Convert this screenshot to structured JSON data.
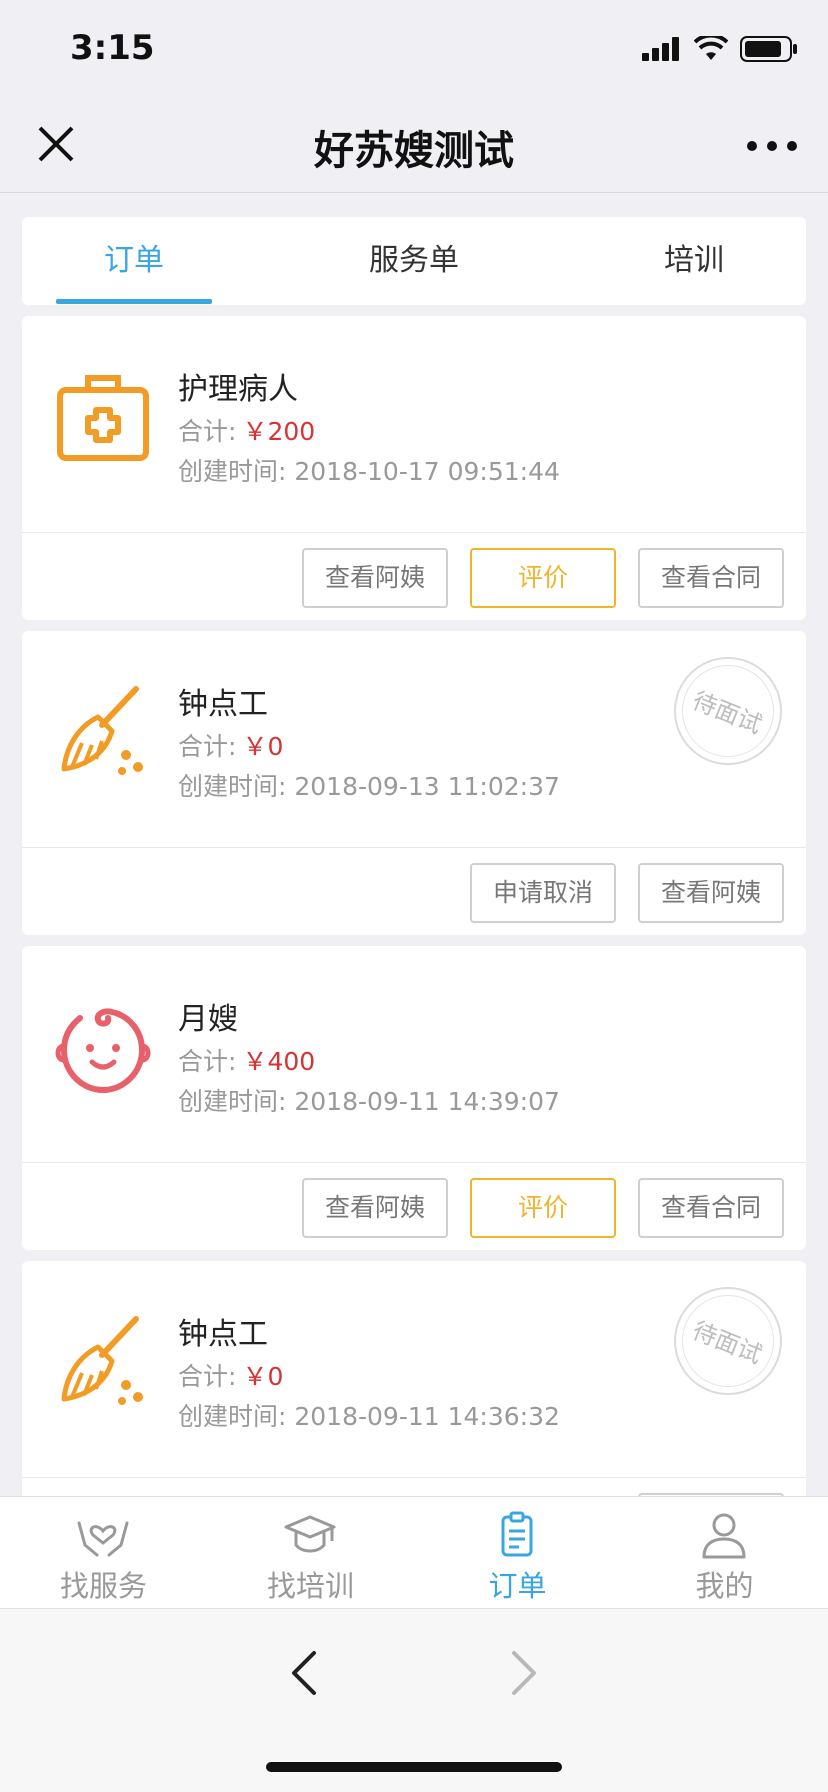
{
  "status_bar": {
    "time": "3:15"
  },
  "nav": {
    "title": "好苏嫂测试"
  },
  "tabs": [
    {
      "label": "订单",
      "active": true
    },
    {
      "label": "服务单",
      "active": false
    },
    {
      "label": "培训",
      "active": false
    }
  ],
  "orders": [
    {
      "icon": "medical-kit-icon",
      "title": "护理病人",
      "total_label": "合计:",
      "price": "￥200",
      "time": "创建时间: 2018-10-17 09:51:44",
      "stamp": "",
      "buttons": [
        "查看阿姨",
        "评价",
        "查看合同"
      ]
    },
    {
      "icon": "broom-icon",
      "title": "钟点工",
      "total_label": "合计:",
      "price": "￥0",
      "time": "创建时间: 2018-09-13 11:02:37",
      "stamp": "待面试",
      "buttons": [
        "申请取消",
        "查看阿姨"
      ]
    },
    {
      "icon": "baby-face-icon",
      "title": "月嫂",
      "total_label": "合计:",
      "price": "￥400",
      "time": "创建时间: 2018-09-11 14:39:07",
      "stamp": "",
      "buttons": [
        "查看阿姨",
        "评价",
        "查看合同"
      ]
    },
    {
      "icon": "broom-icon",
      "title": "钟点工",
      "total_label": "合计:",
      "price": "￥0",
      "time": "创建时间: 2018-09-11 14:36:32",
      "stamp": "待面试",
      "buttons": []
    }
  ],
  "tabbar": [
    {
      "label": "找服务",
      "icon": "heart-hands-icon",
      "active": false
    },
    {
      "label": "找培训",
      "icon": "graduation-cap-icon",
      "active": false
    },
    {
      "label": "订单",
      "icon": "clipboard-icon",
      "active": true
    },
    {
      "label": "我的",
      "icon": "user-icon",
      "active": false
    }
  ],
  "colors": {
    "accent": "#3aa6df",
    "price": "#d83232",
    "gold": "#f0b42b",
    "orange_icon": "#f29b25",
    "pink_icon": "#e8606a"
  }
}
